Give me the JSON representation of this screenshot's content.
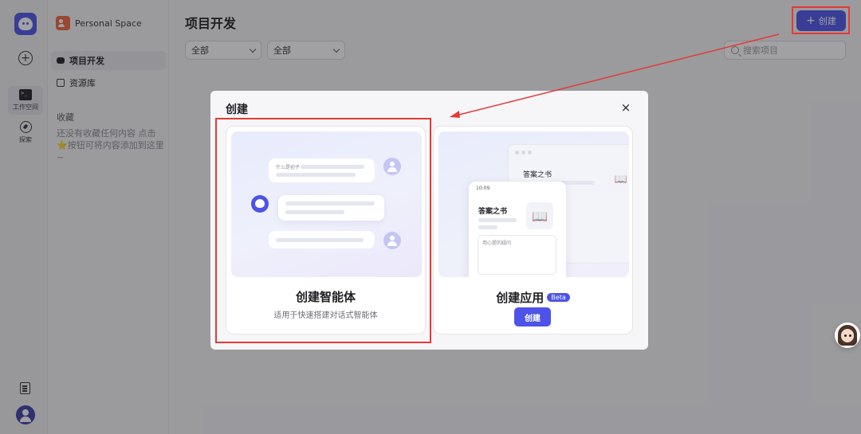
{
  "rail": {
    "workspace_label": "工作空间",
    "explore_label": "探索"
  },
  "sidebar": {
    "space_name": "Personal Space",
    "items": [
      {
        "label": "项目开发"
      },
      {
        "label": "资源库"
      }
    ],
    "favorites_title": "收藏",
    "favorites_empty": "还没有收藏任何内容 点击⭐按钮可将内容添加到这里~"
  },
  "main": {
    "title": "项目开发",
    "create_label": "创建",
    "filters": [
      {
        "value": "全部"
      },
      {
        "value": "全部"
      }
    ],
    "search_placeholder": "搜索项目"
  },
  "modal": {
    "title": "创建",
    "close_glyph": "×",
    "agent_card": {
      "title": "创建智能体",
      "subtitle": "适用于快速搭建对话式智能体",
      "preview_question": "什么是初子"
    },
    "app_card": {
      "title": "创建应用",
      "badge": "Beta",
      "button": "创建",
      "preview_title": "答案之书",
      "preview_time": "10:09",
      "preview_placeholder": "用心提的疑问"
    }
  },
  "colors": {
    "accent": "#4d53e8",
    "annotation": "#e53935"
  }
}
